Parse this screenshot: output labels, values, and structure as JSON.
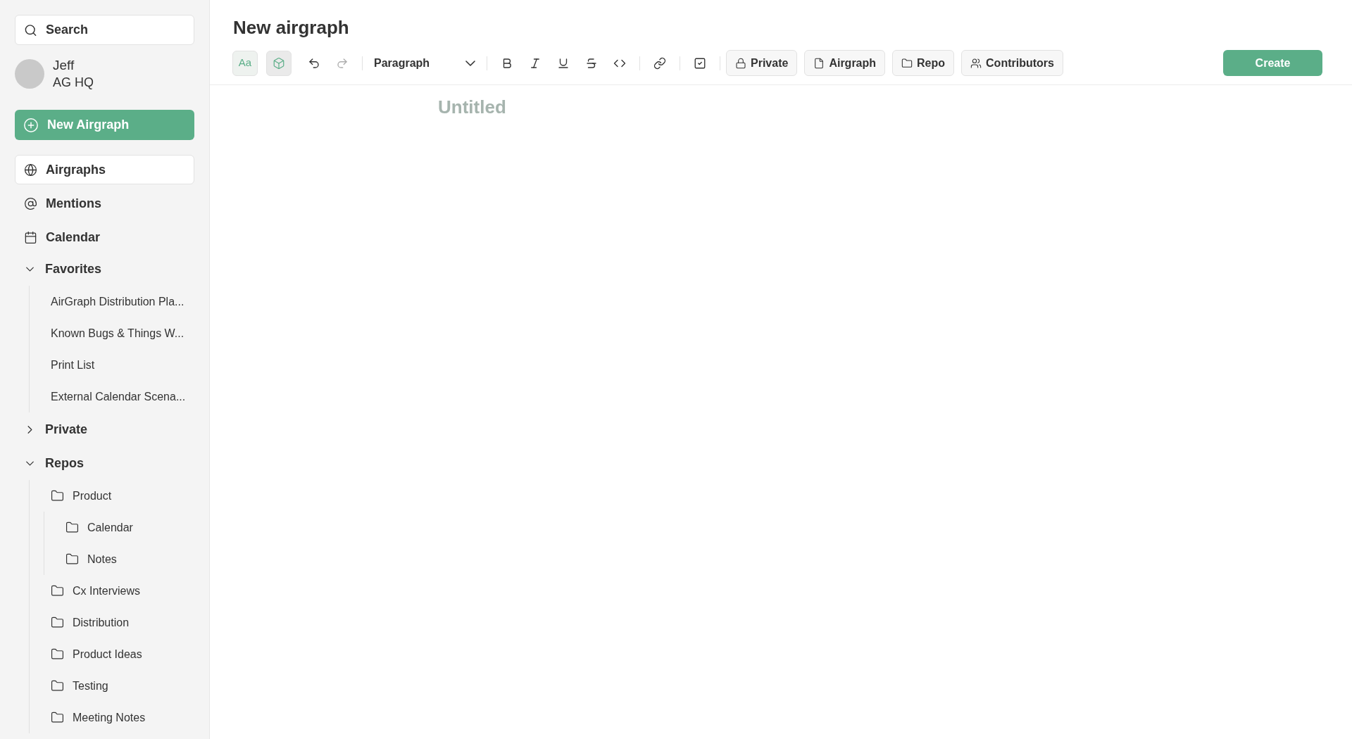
{
  "sidebar": {
    "search": {
      "placeholder": "Search"
    },
    "user": {
      "name": "Jeff",
      "workspace": "AG HQ"
    },
    "new_button": "New Airgraph",
    "nav": [
      {
        "kind": "globe",
        "label": "Airgraphs",
        "selected": true
      },
      {
        "kind": "at",
        "label": "Mentions",
        "selected": false
      },
      {
        "kind": "calendar",
        "label": "Calendar",
        "selected": false
      }
    ],
    "sections": [
      {
        "label": "Favorites",
        "kind": "docs",
        "expanded": true,
        "items": [
          {
            "label": "AirGraph Distribution Pla..."
          },
          {
            "label": "Known Bugs & Things W..."
          },
          {
            "label": "Print List"
          },
          {
            "label": "External Calendar Scena..."
          }
        ]
      },
      {
        "label": "Private",
        "expanded": false
      },
      {
        "label": "Repos",
        "kind": "folders",
        "expanded": true,
        "items": [
          {
            "label": "Product",
            "children": [
              {
                "label": "Calendar"
              },
              {
                "label": "Notes"
              }
            ]
          },
          {
            "label": "Cx Interviews"
          },
          {
            "label": "Distribution"
          },
          {
            "label": "Product Ideas"
          },
          {
            "label": "Testing"
          },
          {
            "label": "Meeting Notes"
          }
        ]
      }
    ]
  },
  "page": {
    "title": "New airgraph",
    "toolbar": {
      "text_style": "Aa",
      "block_style": "Paragraph",
      "redo_disabled": true,
      "chips": [
        {
          "kind": "lock",
          "label": "Private"
        },
        {
          "kind": "file",
          "label": "Airgraph"
        },
        {
          "kind": "folder",
          "label": "Repo"
        },
        {
          "kind": "users",
          "label": "Contributors"
        }
      ],
      "create": "Create"
    },
    "editor": {
      "title_placeholder": "Untitled"
    }
  }
}
